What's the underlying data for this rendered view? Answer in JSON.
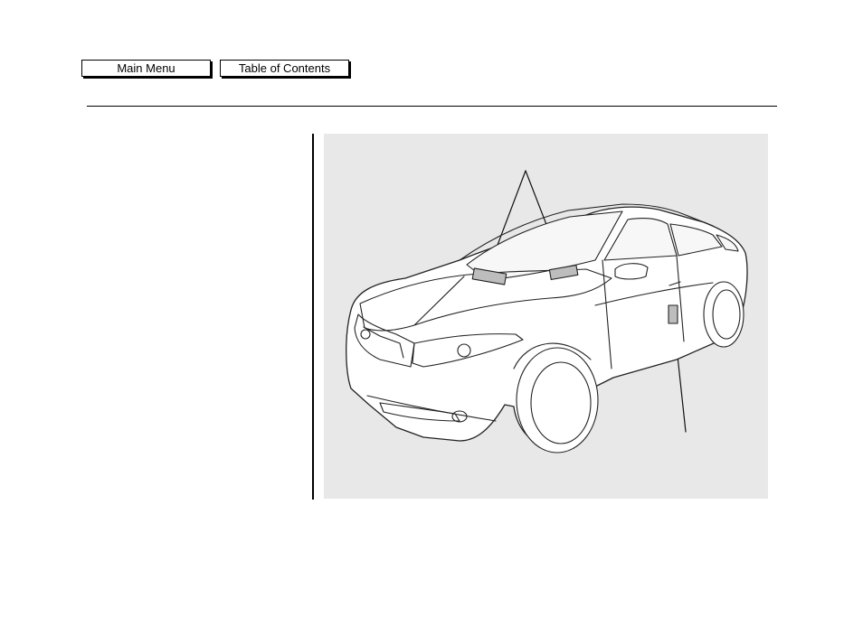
{
  "nav": {
    "main_menu_label": "Main Menu",
    "toc_label": "Table of Contents"
  },
  "figure": {
    "subject": "car-illustration",
    "label_callouts": [
      "windshield-label",
      "under-hood-label",
      "door-jamb-label"
    ],
    "panel_color": "#e8e8e8"
  }
}
